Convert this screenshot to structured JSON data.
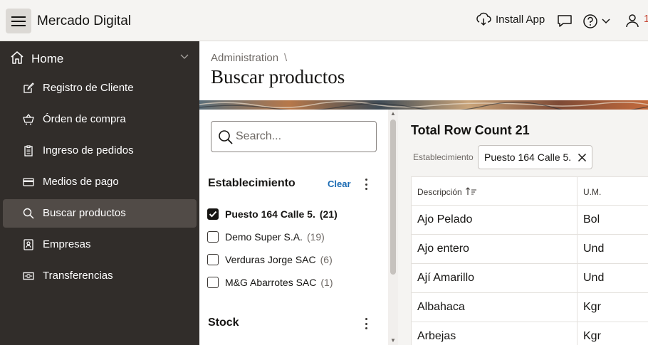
{
  "header": {
    "app_title": "Mercado Digital",
    "install_label": "Install App",
    "user_badge": "1"
  },
  "sidebar": {
    "home_label": "Home",
    "items": [
      {
        "label": "Registro de Cliente",
        "icon": "edit-icon"
      },
      {
        "label": "Órden de compra",
        "icon": "cart-icon"
      },
      {
        "label": "Ingreso de pedidos",
        "icon": "clipboard-icon"
      },
      {
        "label": "Medios de pago",
        "icon": "credit-card-icon"
      },
      {
        "label": "Buscar productos",
        "icon": "search-icon",
        "active": true
      },
      {
        "label": "Empresas",
        "icon": "contact-card-icon"
      },
      {
        "label": "Transferencias",
        "icon": "money-icon"
      }
    ]
  },
  "page": {
    "breadcrumb": "Administration",
    "breadcrumb_sep": "\\",
    "title": "Buscar productos"
  },
  "facets": {
    "search_placeholder": "Search...",
    "establecimiento": {
      "title": "Establecimiento",
      "clear_label": "Clear",
      "options": [
        {
          "label": "Puesto 164 Calle 5.",
          "count": "(21)",
          "checked": true
        },
        {
          "label": "Demo Super S.A.",
          "count": "(19)",
          "checked": false
        },
        {
          "label": "Verduras Jorge SAC",
          "count": "(6)",
          "checked": false
        },
        {
          "label": "M&G Abarrotes SAC",
          "count": "(1)",
          "checked": false
        }
      ]
    },
    "stock": {
      "title": "Stock"
    }
  },
  "results": {
    "row_count": "Total Row Count 21",
    "filter_label": "Establecimiento",
    "filter_chip": "Puesto 164 Calle 5.",
    "columns": [
      "Descripción",
      "U.M."
    ],
    "rows": [
      [
        "Ajo Pelado",
        "Bol"
      ],
      [
        "Ajo entero",
        "Und"
      ],
      [
        "Ají Amarillo",
        "Und"
      ],
      [
        "Albahaca",
        "Kgr"
      ],
      [
        "Arbejas",
        "Kgr"
      ]
    ]
  },
  "colors": {
    "sidebar_bg": "#312d2a",
    "active_item_bg": "#514b47",
    "link": "#1b6bb3",
    "header_bg": "#f5f4f2"
  }
}
